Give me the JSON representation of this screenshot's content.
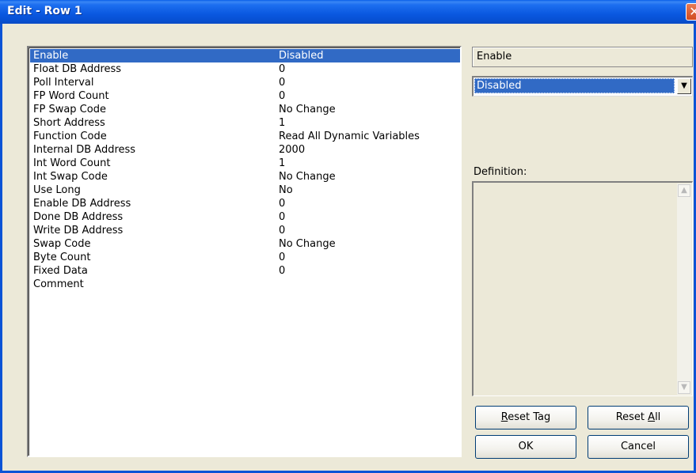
{
  "window": {
    "title": "Edit - Row 1"
  },
  "list": {
    "rows": [
      {
        "name": "Enable",
        "value": "Disabled"
      },
      {
        "name": "Float DB Address",
        "value": "0"
      },
      {
        "name": "Poll Interval",
        "value": "0"
      },
      {
        "name": "FP Word Count",
        "value": "0"
      },
      {
        "name": "FP Swap Code",
        "value": "No Change"
      },
      {
        "name": "Short Address",
        "value": "1"
      },
      {
        "name": "Function Code",
        "value": "Read All Dynamic Variables"
      },
      {
        "name": "Internal DB Address",
        "value": "2000"
      },
      {
        "name": "Int Word Count",
        "value": "1"
      },
      {
        "name": "Int Swap Code",
        "value": "No Change"
      },
      {
        "name": "Use Long",
        "value": "No"
      },
      {
        "name": "Enable DB Address",
        "value": "0"
      },
      {
        "name": "Done DB Address",
        "value": "0"
      },
      {
        "name": "Write DB Address",
        "value": "0"
      },
      {
        "name": "Swap Code",
        "value": "No Change"
      },
      {
        "name": "Byte Count",
        "value": "0"
      },
      {
        "name": "Fixed Data",
        "value": "0"
      },
      {
        "name": "Comment",
        "value": ""
      }
    ]
  },
  "editor": {
    "tag_name": "Enable",
    "selected_value": "Disabled",
    "definition_label": "Definition:",
    "definition_text": ""
  },
  "buttons": {
    "reset_tag": {
      "prefix": "",
      "accel": "R",
      "suffix": "eset Tag"
    },
    "reset_all": {
      "prefix": "Reset ",
      "accel": "A",
      "suffix": "ll"
    },
    "ok": "OK",
    "cancel": "Cancel"
  },
  "colors": {
    "titlebar": "#0a58e0",
    "selection": "#316ac5",
    "dialog_bg": "#ece9d8"
  }
}
